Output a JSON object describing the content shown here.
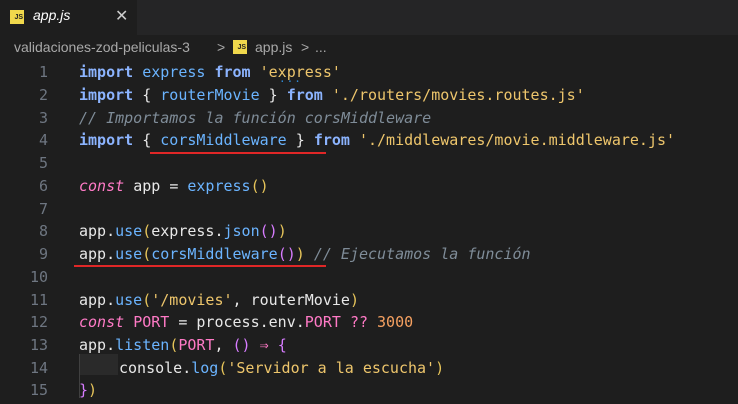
{
  "tab": {
    "title": "app.js",
    "icon": "JS",
    "close": "✕"
  },
  "breadcrumb": {
    "folder": "validaciones-zod-peliculas-3",
    "sep1": ">",
    "file": "app.js",
    "sep2": ">",
    "more": "..."
  },
  "line_numbers": [
    "1",
    "2",
    "3",
    "4",
    "5",
    "6",
    "7",
    "8",
    "9",
    "10",
    "11",
    "12",
    "13",
    "14",
    "15"
  ],
  "code": {
    "l1": {
      "kw": "import",
      "id": "express",
      "from": "from",
      "str": "'express'"
    },
    "l2": {
      "kw": "import",
      "open": "{",
      "id": "routerMovie",
      "close": "}",
      "from": "from",
      "str": "'./routers/movies.routes.js'"
    },
    "l3": {
      "comment": "// Importamos la función corsMiddleware"
    },
    "l4": {
      "kw": "import",
      "open": "{",
      "id": "corsMiddleware",
      "close": "}",
      "from": "from",
      "str": "'./middlewares/movie.middleware.js'"
    },
    "l6": {
      "kw": "const",
      "id": "app",
      "eq": "=",
      "fn": "express",
      "call": "()"
    },
    "l8": {
      "obj": "app",
      "dot": ".",
      "fn": "use",
      "p1": "(",
      "id": "express",
      "dot2": ".",
      "fn2": "json",
      "call": "()",
      "p2": ")"
    },
    "l9": {
      "obj": "app",
      "dot": ".",
      "fn": "use",
      "p1": "(",
      "id": "corsMiddleware",
      "call": "()",
      "p2": ")",
      "comment": "// Ejecutamos la función"
    },
    "l11": {
      "obj": "app",
      "dot": ".",
      "fn": "use",
      "p1": "(",
      "str": "'/movies'",
      "comma": ",",
      "id": "routerMovie",
      "p2": ")"
    },
    "l12": {
      "kw": "const",
      "id": "PORT",
      "eq": "=",
      "obj": "process",
      "dot": ".",
      "env": "env",
      "dot2": ".",
      "port": "PORT",
      "op": "??",
      "num": "3000"
    },
    "l13": {
      "obj": "app",
      "dot": ".",
      "fn": "listen",
      "p1": "(",
      "id": "PORT",
      "comma": ",",
      "arrow_args": "()",
      "arrow": "⇒",
      "brace": "{"
    },
    "l14": {
      "obj": "console",
      "dot": ".",
      "fn": "log",
      "p1": "(",
      "str": "'Servidor a la escucha'",
      "p2": ")"
    },
    "l15": {
      "brace": "}",
      "p2": ")"
    }
  },
  "colors": {
    "background": "#1e1e1e",
    "underline": "#e02727",
    "keyword": "#8cb4ff",
    "string": "#eec66c",
    "comment": "#7f8c98"
  }
}
